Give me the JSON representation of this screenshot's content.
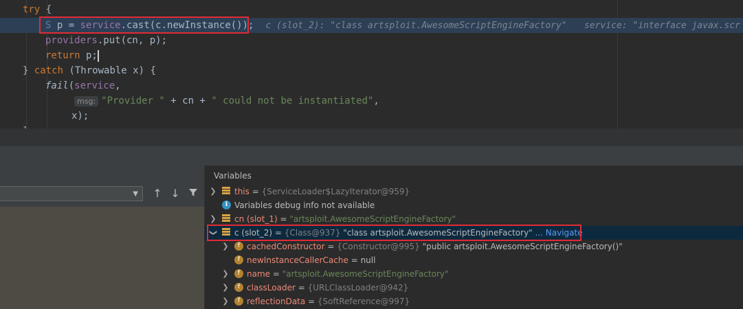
{
  "editor": {
    "lines": [
      {
        "kw": "try",
        "rest": " {"
      },
      {
        "icon": "S",
        "decl": " p = ",
        "svc": "service",
        "call1": ".cast(c.newInstance());",
        "inlay1": "c (slot_2): \"class artsploit.AwesomeScriptEngineFactory\"",
        "inlay2": "service: \"interface javax.scr"
      },
      {
        "fld": "providers",
        "rest": ".put(cn, p);"
      },
      {
        "kw": "return",
        "rest": " p;"
      },
      {
        "a": "} ",
        "kw": "catch",
        "b": " (Throwable x) {"
      },
      {
        "fn": "fail",
        "a": "(",
        "svc": "service",
        "b": ","
      },
      {
        "hint": "msg:",
        "str1": "\"Provider \"",
        "mid": " + cn + ",
        "str2": "\" could not be instantiated\"",
        "end": ","
      },
      {
        "text": "x);"
      },
      {
        "text": "}"
      }
    ]
  },
  "variables": {
    "title": "Variables",
    "rows": [
      {
        "name": "this",
        "eq": " = ",
        "meta": "{ServiceLoader$LazyIterator@959}"
      },
      {
        "text": "Variables debug info not available"
      },
      {
        "name": "cn (slot_1)",
        "eq": " = ",
        "str": "\"artsploit.AwesomeScriptEngineFactory\""
      },
      {
        "name": "c (slot_2)",
        "eq": " = ",
        "meta": "{Class@937}",
        "val": " \"class artsploit.AwesomeScriptEngineFactory\"",
        "link": " ... Navigate"
      },
      {
        "name": "cachedConstructor",
        "eq": " = ",
        "meta": "{Constructor@995}",
        "val": " \"public artsploit.AwesomeScriptEngineFactory()\""
      },
      {
        "name": "newInstanceCallerCache",
        "eq": " = ",
        "val": "null"
      },
      {
        "name": "name",
        "eq": " = ",
        "str": "\"artsploit.AwesomeScriptEngineFactory\""
      },
      {
        "name": "classLoader",
        "eq": " = ",
        "meta": "{URLClassLoader@942}"
      },
      {
        "name": "reflectionData",
        "eq": " = ",
        "meta": "{SoftReference@997}"
      }
    ]
  },
  "icons": {
    "expand": "chevron-right-icon",
    "collapse": "chevron-down-icon",
    "up": "arrow-up-icon",
    "down": "arrow-down-icon",
    "filter": "filter-icon",
    "info": "info-icon",
    "field": "field-icon",
    "object": "object-stack-icon"
  },
  "colors": {
    "highlight_box": "#e22b36",
    "selection": "#0d293e",
    "exec_line": "#2d3f55"
  }
}
